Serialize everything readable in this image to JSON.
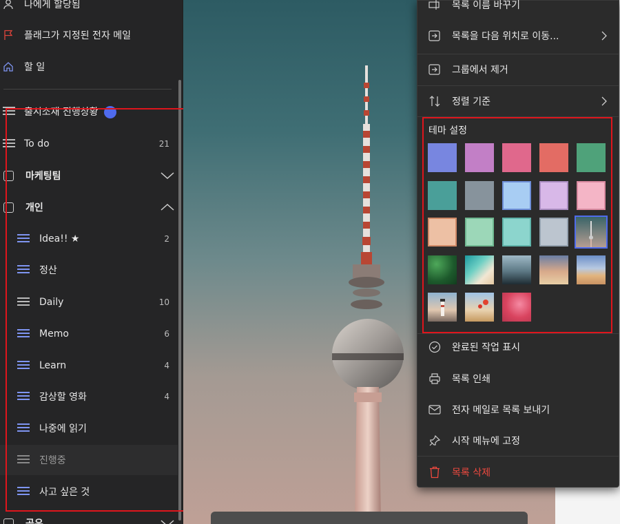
{
  "sidebar": {
    "nav": [
      {
        "label": "나에게 할당됨",
        "icon": "person-icon"
      },
      {
        "label": "플래그가 지정된 전자 메일",
        "icon": "flag-icon"
      },
      {
        "label": "할 일",
        "icon": "home-icon"
      }
    ],
    "lists": [
      {
        "label": "출시소재 진행상황",
        "count": "",
        "icon": "list-icon"
      },
      {
        "label": "To do",
        "count": "21",
        "icon": "list-icon"
      }
    ],
    "groups": [
      {
        "label": "마케팅팀",
        "expanded": false
      },
      {
        "label": "개인",
        "expanded": true
      }
    ],
    "group_items": [
      {
        "label": "Idea!! ★",
        "count": "2"
      },
      {
        "label": "정산",
        "count": ""
      },
      {
        "label": "Daily",
        "count": "10"
      },
      {
        "label": "Memo",
        "count": "6"
      },
      {
        "label": "Learn",
        "count": "4"
      },
      {
        "label": "감상할 영화",
        "count": "4"
      },
      {
        "label": "나중에 읽기",
        "count": ""
      },
      {
        "label": "진행중",
        "count": ""
      },
      {
        "label": "사고 싶은 것",
        "count": ""
      }
    ],
    "bottom_group": "공유"
  },
  "menu": {
    "items_top": [
      {
        "label": "목록 이름 바꾸기",
        "icon": "rename-icon"
      },
      {
        "label": "목록을 다음 위치로 이동...",
        "icon": "move-icon",
        "submenu": true
      },
      {
        "label": "그룹에서 제거",
        "icon": "remove-from-group-icon"
      },
      {
        "label": "정렬 기준",
        "icon": "sort-icon",
        "submenu": true
      }
    ],
    "theme_title": "테마 설정",
    "theme_colors": [
      "#7886e0",
      "#c27fc6",
      "#e0688c",
      "#e36c64",
      "#4fa27a",
      "#4a9f99",
      "#87939c",
      "#a8cdf3",
      "#d8b8e8",
      "#f4b5c6",
      "#edc0a4",
      "#9cd7b8",
      "#8cd5cd",
      "#bcc5cf"
    ],
    "theme_photos": [
      "tower",
      "leaves",
      "beach",
      "mountains",
      "palms",
      "desert",
      "lighthouse",
      "flowers",
      "pink"
    ],
    "items_bottom": [
      {
        "label": "완료된 작업 표시",
        "icon": "check-circle-icon"
      },
      {
        "label": "목록 인쇄",
        "icon": "print-icon"
      },
      {
        "label": "전자 메일로 목록 보내기",
        "icon": "mail-icon"
      },
      {
        "label": "시작 메뉴에 고정",
        "icon": "pin-icon"
      }
    ],
    "delete_label": "목록 삭제",
    "danger_color": "#f0493f",
    "accent_color": "#4f6bed"
  }
}
